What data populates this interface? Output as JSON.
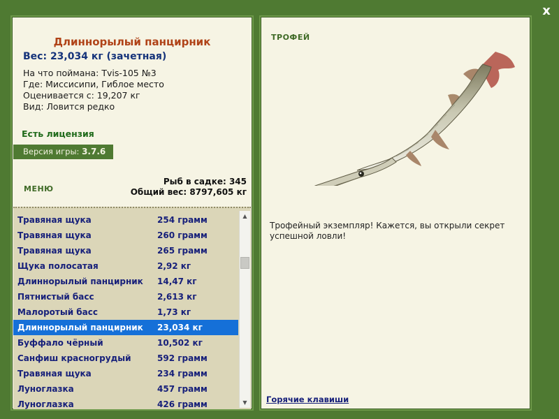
{
  "close_label": "x",
  "fish": {
    "name": "Длиннорылый панцирник",
    "weight": "Вес: 23,034 кг (зачетная)",
    "caught_with": "На что поймана: Tvis-105 №3",
    "location": "Где: Миссисипи, Гиблое место",
    "valued_from": "Оценивается с: 19,207 кг",
    "kind": "Вид: Ловится редко"
  },
  "license": "Есть лицензия",
  "version": {
    "label": "Версия игры:",
    "number": "3.7.6"
  },
  "menu_label": "МЕНЮ",
  "stats": {
    "fish_in_keepnet": "Рыб в садке: 345",
    "total_weight": "Общий вес: 8797,605 кг"
  },
  "catches": [
    {
      "name": "Травяная щука",
      "weight": "254 грамм",
      "selected": false
    },
    {
      "name": "Травяная щука",
      "weight": "260 грамм",
      "selected": false
    },
    {
      "name": "Травяная щука",
      "weight": "265 грамм",
      "selected": false
    },
    {
      "name": "Щука полосатая",
      "weight": "2,92 кг",
      "selected": false
    },
    {
      "name": "Длиннорылый панцирник",
      "weight": "14,47 кг",
      "selected": false
    },
    {
      "name": "Пятнистый басс",
      "weight": "2,613 кг",
      "selected": false
    },
    {
      "name": "Малоротый басс",
      "weight": "1,73 кг",
      "selected": false
    },
    {
      "name": "Длиннорылый панцирник",
      "weight": "23,034 кг",
      "selected": true
    },
    {
      "name": "Буффало чёрный",
      "weight": "10,502 кг",
      "selected": false
    },
    {
      "name": "Санфиш красногрудый",
      "weight": "592 грамм",
      "selected": false
    },
    {
      "name": "Травяная щука",
      "weight": "234 грамм",
      "selected": false
    },
    {
      "name": "Луноглазка",
      "weight": "457 грамм",
      "selected": false
    },
    {
      "name": "Луноглазка",
      "weight": "426 грамм",
      "selected": false
    }
  ],
  "trophy": {
    "label": "ТРОФЕЙ",
    "text": "Трофейный экземпляр! Кажется, вы открыли секрет успешной ловли!"
  },
  "hotkeys_link": "Горячие клавиши",
  "icons": {
    "scroll_up": "▲",
    "scroll_down": "▼"
  },
  "colors": {
    "background": "#4f7a32",
    "panel": "#f6f4e4",
    "fish_name": "#b04318",
    "selection": "#1570d8",
    "list_text": "#17207a"
  }
}
